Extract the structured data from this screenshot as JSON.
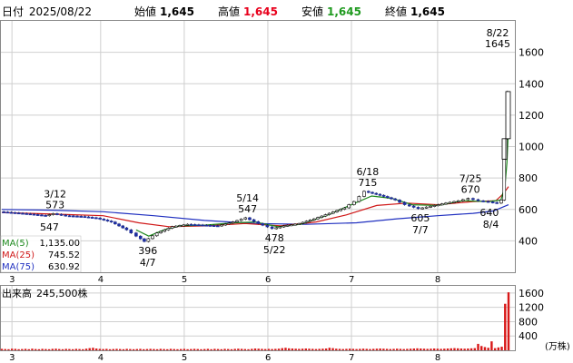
{
  "header": {
    "date_label": "日付",
    "date": "2025/08/22",
    "open_label": "始値",
    "open": "1,645",
    "high_label": "高値",
    "high": "1,645",
    "low_label": "安値",
    "low": "1,645",
    "close_label": "終値",
    "close": "1,645"
  },
  "colors": {
    "up": "#1e2fa0",
    "down": "#000000",
    "high": "#e8001c",
    "low": "#1f9a1f",
    "ma5": "#1f8a1f",
    "ma25": "#d01818",
    "ma75": "#2030c0",
    "volume": "#d81818"
  },
  "chart_data": {
    "type": "candlestick",
    "price_axis": {
      "ylim": [
        200,
        1800
      ],
      "ticks": [
        "400",
        "600",
        "800",
        "1000",
        "1200",
        "1400",
        "1600"
      ]
    },
    "month_ticks": [
      "3",
      "4",
      "5",
      "6",
      "7",
      "8"
    ],
    "ma_legend": [
      {
        "name": "MA(5)",
        "value": "1,135.00"
      },
      {
        "name": "MA(25)",
        "value": "745.52"
      },
      {
        "name": "MA(75)",
        "value": "630.92"
      }
    ],
    "annotations": [
      {
        "date": "3/12",
        "value": "573",
        "x": 0.105,
        "y": 573
      },
      {
        "date": "",
        "value": "547",
        "x": 0.094,
        "y": 547
      },
      {
        "date": "4/7",
        "value": "396",
        "x": 0.288,
        "y": 396
      },
      {
        "date": "5/14",
        "value": "547",
        "x": 0.485,
        "y": 547
      },
      {
        "date": "5/22",
        "value": "478",
        "x": 0.538,
        "y": 478
      },
      {
        "date": "6/18",
        "value": "715",
        "x": 0.722,
        "y": 715
      },
      {
        "date": "7/7",
        "value": "605",
        "x": 0.826,
        "y": 605
      },
      {
        "date": "7/25",
        "value": "670",
        "x": 0.925,
        "y": 670
      },
      {
        "date": "8/4",
        "value": "640",
        "x": 0.981,
        "y": 640
      },
      {
        "date": "8/22",
        "value": "1645",
        "x": 1.0,
        "y": 1645
      }
    ],
    "price_series": [
      {
        "x": 0.0,
        "y": 585
      },
      {
        "x": 0.03,
        "y": 578
      },
      {
        "x": 0.06,
        "y": 570
      },
      {
        "x": 0.09,
        "y": 560
      },
      {
        "x": 0.105,
        "y": 573
      },
      {
        "x": 0.13,
        "y": 560
      },
      {
        "x": 0.16,
        "y": 555
      },
      {
        "x": 0.19,
        "y": 545
      },
      {
        "x": 0.22,
        "y": 520
      },
      {
        "x": 0.25,
        "y": 470
      },
      {
        "x": 0.27,
        "y": 430
      },
      {
        "x": 0.285,
        "y": 396
      },
      {
        "x": 0.31,
        "y": 450
      },
      {
        "x": 0.34,
        "y": 490
      },
      {
        "x": 0.37,
        "y": 505
      },
      {
        "x": 0.4,
        "y": 500
      },
      {
        "x": 0.43,
        "y": 495
      },
      {
        "x": 0.46,
        "y": 520
      },
      {
        "x": 0.485,
        "y": 547
      },
      {
        "x": 0.51,
        "y": 510
      },
      {
        "x": 0.538,
        "y": 478
      },
      {
        "x": 0.56,
        "y": 495
      },
      {
        "x": 0.59,
        "y": 510
      },
      {
        "x": 0.62,
        "y": 540
      },
      {
        "x": 0.65,
        "y": 575
      },
      {
        "x": 0.68,
        "y": 610
      },
      {
        "x": 0.7,
        "y": 650
      },
      {
        "x": 0.72,
        "y": 715
      },
      {
        "x": 0.75,
        "y": 690
      },
      {
        "x": 0.78,
        "y": 660
      },
      {
        "x": 0.8,
        "y": 630
      },
      {
        "x": 0.826,
        "y": 605
      },
      {
        "x": 0.85,
        "y": 620
      },
      {
        "x": 0.88,
        "y": 640
      },
      {
        "x": 0.905,
        "y": 655
      },
      {
        "x": 0.925,
        "y": 670
      },
      {
        "x": 0.945,
        "y": 655
      },
      {
        "x": 0.965,
        "y": 648
      },
      {
        "x": 0.981,
        "y": 640
      },
      {
        "x": 0.99,
        "y": 660
      },
      {
        "x": 0.993,
        "y": 920
      },
      {
        "x": 0.996,
        "y": 1050
      },
      {
        "x": 1.0,
        "y": 1350
      }
    ],
    "ma5": [
      {
        "x": 0.265,
        "y": 470
      },
      {
        "x": 0.29,
        "y": 430
      },
      {
        "x": 0.32,
        "y": 470
      },
      {
        "x": 0.35,
        "y": 495
      },
      {
        "x": 0.4,
        "y": 500
      },
      {
        "x": 0.46,
        "y": 515
      },
      {
        "x": 0.5,
        "y": 520
      },
      {
        "x": 0.545,
        "y": 490
      },
      {
        "x": 0.59,
        "y": 505
      },
      {
        "x": 0.64,
        "y": 560
      },
      {
        "x": 0.69,
        "y": 630
      },
      {
        "x": 0.73,
        "y": 685
      },
      {
        "x": 0.77,
        "y": 670
      },
      {
        "x": 0.81,
        "y": 630
      },
      {
        "x": 0.86,
        "y": 625
      },
      {
        "x": 0.91,
        "y": 655
      },
      {
        "x": 0.96,
        "y": 650
      },
      {
        "x": 0.985,
        "y": 660
      },
      {
        "x": 0.993,
        "y": 750
      },
      {
        "x": 0.997,
        "y": 900
      },
      {
        "x": 1.0,
        "y": 1135
      }
    ],
    "ma25": [
      {
        "x": 0.0,
        "y": 580
      },
      {
        "x": 0.1,
        "y": 570
      },
      {
        "x": 0.2,
        "y": 560
      },
      {
        "x": 0.27,
        "y": 515
      },
      {
        "x": 0.33,
        "y": 490
      },
      {
        "x": 0.4,
        "y": 495
      },
      {
        "x": 0.48,
        "y": 510
      },
      {
        "x": 0.55,
        "y": 495
      },
      {
        "x": 0.62,
        "y": 520
      },
      {
        "x": 0.68,
        "y": 565
      },
      {
        "x": 0.74,
        "y": 625
      },
      {
        "x": 0.8,
        "y": 640
      },
      {
        "x": 0.86,
        "y": 630
      },
      {
        "x": 0.93,
        "y": 650
      },
      {
        "x": 0.975,
        "y": 655
      },
      {
        "x": 0.99,
        "y": 700
      },
      {
        "x": 1.0,
        "y": 745
      }
    ],
    "ma75": [
      {
        "x": 0.0,
        "y": 600
      },
      {
        "x": 0.1,
        "y": 595
      },
      {
        "x": 0.2,
        "y": 585
      },
      {
        "x": 0.3,
        "y": 560
      },
      {
        "x": 0.4,
        "y": 530
      },
      {
        "x": 0.5,
        "y": 510
      },
      {
        "x": 0.6,
        "y": 505
      },
      {
        "x": 0.7,
        "y": 515
      },
      {
        "x": 0.78,
        "y": 540
      },
      {
        "x": 0.86,
        "y": 560
      },
      {
        "x": 0.93,
        "y": 575
      },
      {
        "x": 0.97,
        "y": 590
      },
      {
        "x": 1.0,
        "y": 630
      }
    ],
    "volume": {
      "label": "出来高",
      "value": "245,500株",
      "unit": "(万株)",
      "ylim": [
        0,
        1800
      ],
      "ticks": [
        "400",
        "800",
        "1200",
        "1600"
      ],
      "values": [
        40,
        35,
        30,
        45,
        40,
        30,
        35,
        40,
        30,
        45,
        35,
        30,
        40,
        35,
        30,
        40,
        45,
        35,
        30,
        40,
        35,
        30,
        40,
        35,
        30,
        45,
        60,
        70,
        50,
        40,
        35,
        40,
        30,
        35,
        40,
        35,
        30,
        40,
        35,
        30,
        35,
        40,
        30,
        35,
        40,
        35,
        30,
        40,
        35,
        30,
        40,
        35,
        30,
        35,
        40,
        30,
        35,
        40,
        35,
        30,
        35,
        40,
        30,
        40,
        35,
        30,
        40,
        35,
        30,
        40,
        45,
        40,
        35,
        30,
        40,
        50,
        45,
        40,
        35,
        40,
        35,
        40,
        45,
        60,
        70,
        55,
        50,
        45,
        40,
        45,
        50,
        45,
        40,
        35,
        40,
        45,
        50,
        70,
        60,
        45,
        40,
        35,
        40,
        45,
        40,
        35,
        40,
        45,
        40,
        35,
        40,
        45,
        50,
        45,
        40,
        35,
        40,
        45,
        40,
        35,
        40,
        45,
        50,
        55,
        50,
        45,
        40,
        45,
        50,
        45,
        40,
        45,
        50,
        55,
        60,
        55,
        50,
        45,
        50,
        55,
        60,
        180,
        120,
        90,
        70,
        250,
        60,
        80,
        100,
        1300,
        1620
      ]
    }
  }
}
